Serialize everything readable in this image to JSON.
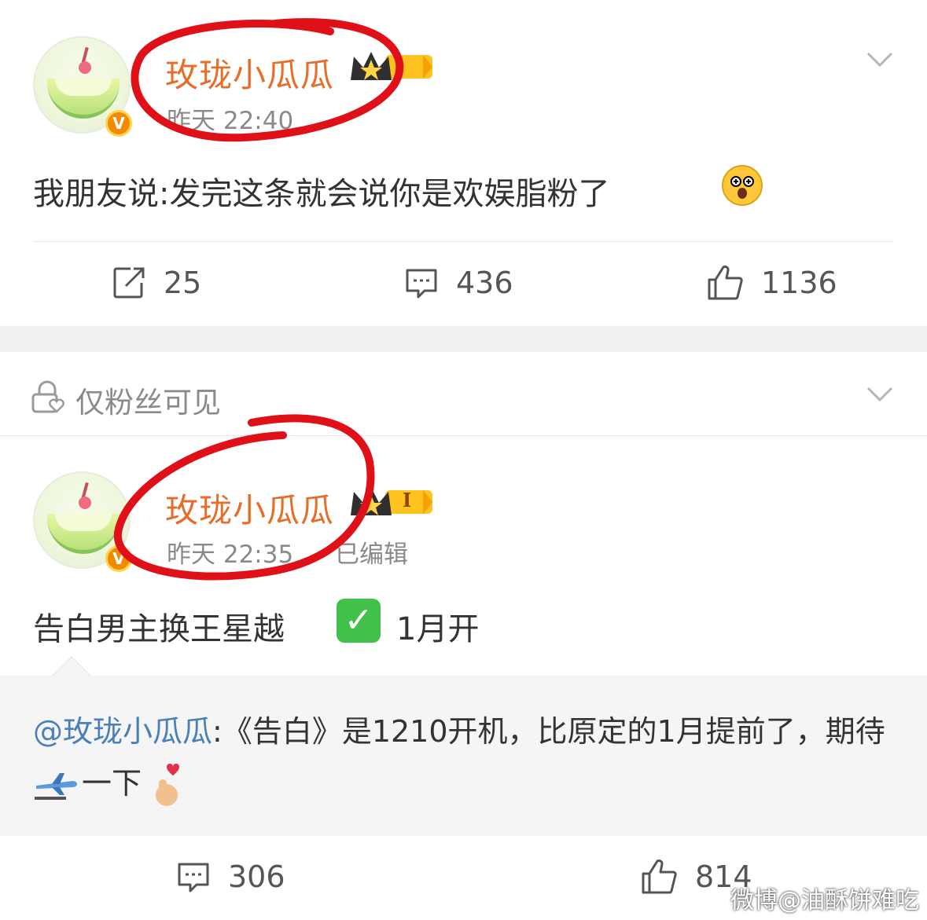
{
  "post1": {
    "username": "玫珑小瓜瓜",
    "time": "昨天 22:40",
    "badge_letter": "V",
    "text": "我朋友说:发完这条就会说你是欢娱脂粉了",
    "emoji": "hugging-face-emoji",
    "actions": {
      "repost_count": "25",
      "comment_count": "436",
      "like_count": "1136"
    }
  },
  "visibility": {
    "label": "仅粉丝可见"
  },
  "post2": {
    "username": "玫珑小瓜瓜",
    "time": "昨天 22:35",
    "edited": "已编辑",
    "badge_letter": "V",
    "level_tag": "I",
    "text": "告白男主换王星越",
    "text_suffix": "1月开",
    "check_emoji": "✓",
    "quote": {
      "mention": "@玫珑小瓜瓜",
      "body": ":《告白》是1210开机，比原定的1月提前了，期待",
      "after_plane": "一下"
    },
    "actions": {
      "comment_count": "306",
      "like_count": "814"
    }
  },
  "watermark": "微博@油酥饼难吃",
  "colors": {
    "username": "#e66e2a",
    "mention": "#4a7fb7",
    "annotation_red": "#e01018",
    "separator": "#f1f1f1"
  }
}
